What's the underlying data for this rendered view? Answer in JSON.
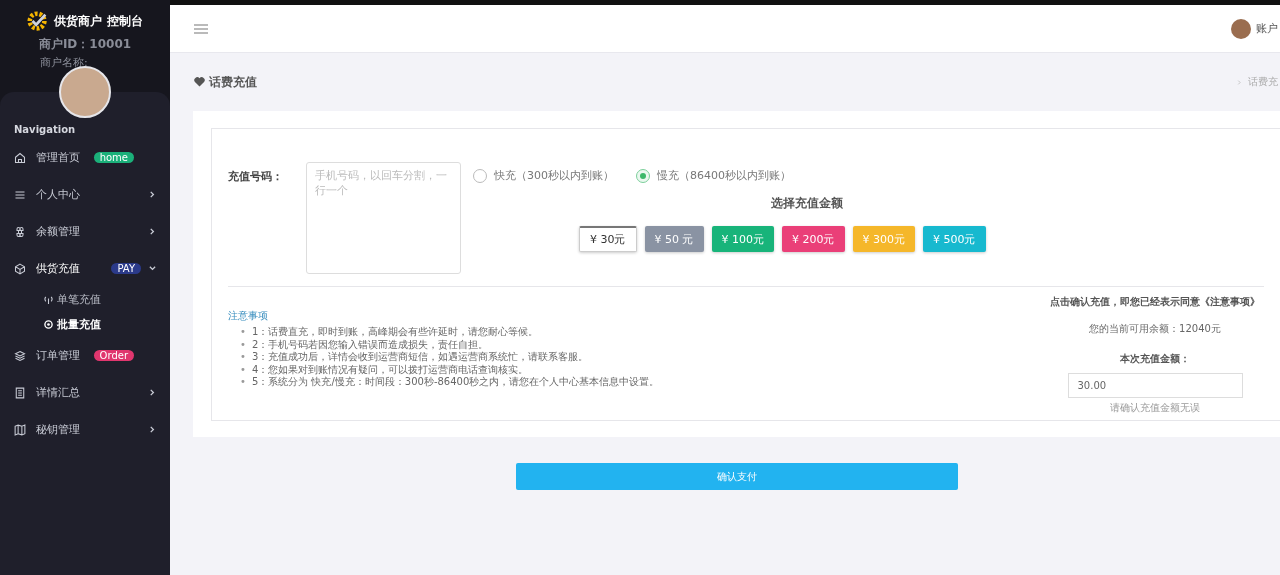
{
  "sidebar": {
    "brand": "供货商户 控制台",
    "merchant_id": "商户ID：10001",
    "merchant_name_label": "商户名称:",
    "nav_heading": "Navigation",
    "items": [
      {
        "label": "管理首页",
        "badge": "home",
        "color": "#1bb07a",
        "expanded": false
      },
      {
        "label": "个人中心",
        "expanded": false
      },
      {
        "label": "余额管理",
        "expanded": false
      },
      {
        "label": "供货充值",
        "badge": "PAY",
        "color": "#2b3a8a",
        "expanded": true,
        "children": [
          {
            "label": "单笔充值",
            "selected": false
          },
          {
            "label": "批量充值",
            "selected": true
          }
        ]
      },
      {
        "label": "订单管理",
        "badge": "Order",
        "color": "#e0366e",
        "expanded": false
      },
      {
        "label": "详情汇总",
        "expanded": false
      },
      {
        "label": "秘钥管理",
        "expanded": false
      }
    ]
  },
  "header": {
    "account": "账户"
  },
  "page": {
    "title": "话费充值",
    "breadcrumb": "话费充"
  },
  "form": {
    "number_label": "充值号码：",
    "number_placeholder": "手机号码，以回车分割，一行一个",
    "modes": [
      {
        "label": "快充（300秒以内到账）",
        "selected": false
      },
      {
        "label": "慢充（86400秒以内到账）",
        "selected": true
      }
    ],
    "amount_title": "选择充值金额",
    "amounts": [
      {
        "label": "¥ 30元",
        "color": "#ffffff",
        "selected": true
      },
      {
        "label": "¥ 50 元",
        "color": "#8a93a3",
        "selected": false
      },
      {
        "label": "¥ 100元",
        "color": "#18b47a",
        "selected": false
      },
      {
        "label": "¥ 200元",
        "color": "#ea3f78",
        "selected": false
      },
      {
        "label": "¥ 300元",
        "color": "#f5b72a",
        "selected": false
      },
      {
        "label": "¥ 500元",
        "color": "#17b9cf",
        "selected": false
      }
    ],
    "notes_title": "注意事项",
    "notes": [
      {
        "bullet": "•",
        "text": "1：话费直充，即时到账，高峰期会有些许延时，请您耐心等候。"
      },
      {
        "bullet": "•",
        "text": "2：手机号码若因您输入错误而造成损失，责任自担。"
      },
      {
        "bullet": "•",
        "text": "3：充值成功后，详情会收到运营商短信，如遇运营商系统忙，请联系客服。"
      },
      {
        "bullet": "•",
        "text": "4：您如果对到账情况有疑问，可以拨打运营商电话查询核实。"
      },
      {
        "bullet": "•",
        "text": "5：系统分为 快充/慢充：时间段：300秒-86400秒之内，请您在个人中心基本信息中设置。"
      }
    ],
    "agree_text": "点击确认充值，即您已经表示同意《注意事项》",
    "balance": "您的当前可用余额：12040元",
    "amount_label": "本次充值金额：",
    "amount_value": "30.00",
    "amount_hint": "请确认充值金额无误",
    "submit": "确认支付"
  }
}
